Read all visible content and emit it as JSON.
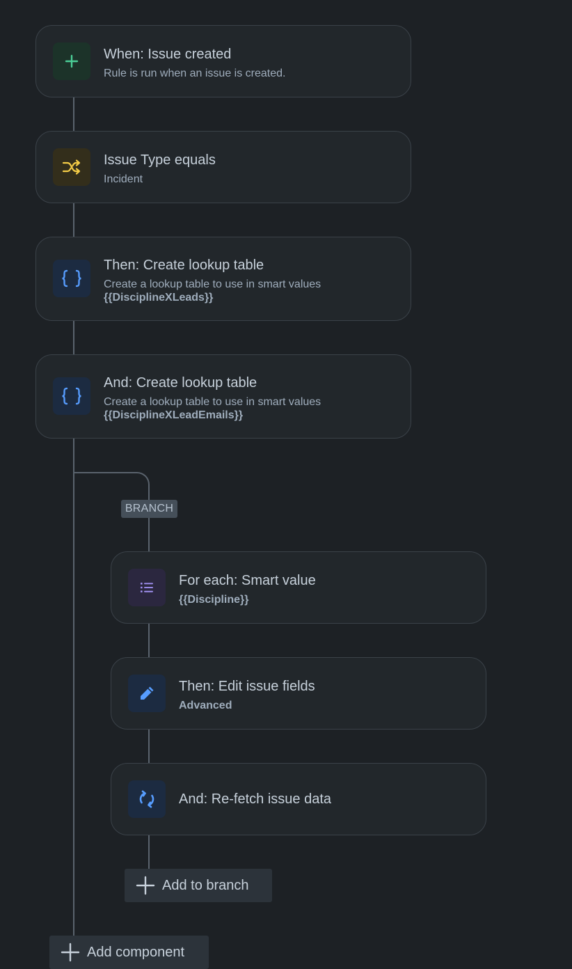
{
  "rules": [
    {
      "title": "When: Issue created",
      "subtitle": "Rule is run when an issue is created.",
      "icon": "plus-icon",
      "icon_color": "#4bce97",
      "icon_bg": "#1c3329"
    },
    {
      "title": "Issue Type equals",
      "subtitle": "Incident",
      "icon": "shuffle-icon",
      "icon_color": "#f5cd47",
      "icon_bg": "#332e1b"
    },
    {
      "title": "Then: Create lookup table",
      "subtitle": "Create a lookup table to use in smart values",
      "detail": "{{DisciplineXLeads}}",
      "icon": "braces-icon",
      "icon_color": "#579dff",
      "icon_bg": "#1c2b41"
    },
    {
      "title": "And: Create lookup table",
      "subtitle": "Create a lookup table to use in smart values",
      "detail": "{{DisciplineXLeadEmails}}",
      "icon": "braces-icon",
      "icon_color": "#579dff",
      "icon_bg": "#1c2b41"
    }
  ],
  "branch": {
    "label": "BRANCH",
    "items": [
      {
        "title": "For each: Smart value",
        "subtitle": "{{Discipline}}",
        "icon": "list-icon",
        "icon_color": "#9f8fef",
        "icon_bg": "#2b273f"
      },
      {
        "title": "Then: Edit issue fields",
        "subtitle": "Advanced",
        "icon": "pencil-icon",
        "icon_color": "#579dff",
        "icon_bg": "#1c2b41"
      },
      {
        "title": "And: Re-fetch issue data",
        "icon": "refresh-icon",
        "icon_color": "#579dff",
        "icon_bg": "#1c2b41"
      }
    ],
    "add_label": "Add to branch"
  },
  "add_component_label": "Add component"
}
